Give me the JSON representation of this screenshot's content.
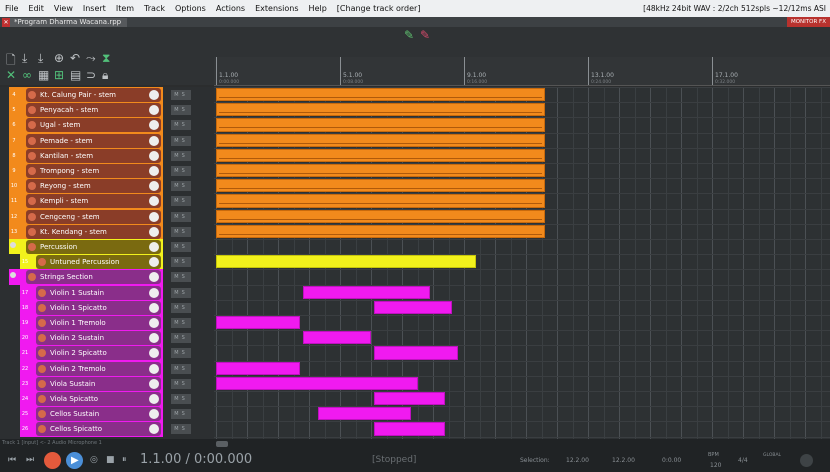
{
  "menu": {
    "items": [
      "File",
      "Edit",
      "View",
      "Insert",
      "Item",
      "Track",
      "Options",
      "Actions",
      "Extensions",
      "Help",
      "[Change track order]"
    ],
    "status": "[48kHz 24bit WAV : 2/2ch 512spls ~12/12ms ASI"
  },
  "project": {
    "tab": "*Program Dharma Wacana.rpp",
    "monitor": "MONITOR FX"
  },
  "ruler": [
    {
      "label": "1.1.00",
      "sub": "0:00.000"
    },
    {
      "label": "5.1.00",
      "sub": "0:08.000"
    },
    {
      "label": "9.1.00",
      "sub": "0:16.000"
    },
    {
      "label": "13.1.00",
      "sub": "0:24.000"
    },
    {
      "label": "17.1.00",
      "sub": "0:32.000"
    }
  ],
  "tracks": [
    {
      "num": "4",
      "name": "Kt. Calung Pair - stem",
      "color": "#f28a1c"
    },
    {
      "num": "5",
      "name": "Penyacah - stem",
      "color": "#f28a1c"
    },
    {
      "num": "6",
      "name": "Ugal - stem",
      "color": "#f28a1c"
    },
    {
      "num": "7",
      "name": "Pemade - stem",
      "color": "#f28a1c"
    },
    {
      "num": "8",
      "name": "Kantilan - stem",
      "color": "#f28a1c"
    },
    {
      "num": "9",
      "name": "Trompong - stem",
      "color": "#f28a1c"
    },
    {
      "num": "10",
      "name": "Reyong - stem",
      "color": "#f28a1c"
    },
    {
      "num": "11",
      "name": "Kempli - stem",
      "color": "#f28a1c"
    },
    {
      "num": "12",
      "name": "Cengceng - stem",
      "color": "#f28a1c"
    },
    {
      "num": "13",
      "name": "Kt. Kendang - stem",
      "color": "#f28a1c"
    },
    {
      "num": "",
      "name": "Percussion",
      "color": "#f2f21c",
      "folder": true
    },
    {
      "num": "15",
      "name": "Untuned Percussion",
      "color": "#f2f21c",
      "child": true
    },
    {
      "num": "",
      "name": "Strings Section",
      "color": "#f01af0",
      "folder": true
    },
    {
      "num": "17",
      "name": "Violin 1 Sustain",
      "color": "#f01af0",
      "child": true
    },
    {
      "num": "18",
      "name": "Violin 1 Spicatto",
      "color": "#f01af0",
      "child": true
    },
    {
      "num": "19",
      "name": "Violin 1 Tremolo",
      "color": "#f01af0",
      "child": true
    },
    {
      "num": "20",
      "name": "Violin 2 Sustain",
      "color": "#f01af0",
      "child": true
    },
    {
      "num": "21",
      "name": "Violin 2 Spicatto",
      "color": "#f01af0",
      "child": true
    },
    {
      "num": "22",
      "name": "Violin 2 Tremolo",
      "color": "#f01af0",
      "child": true
    },
    {
      "num": "23",
      "name": "Viola Sustain",
      "color": "#f01af0",
      "child": true
    },
    {
      "num": "24",
      "name": "Viola Spicatto",
      "color": "#f01af0",
      "child": true
    },
    {
      "num": "25",
      "name": "Cellos Sustain",
      "color": "#f01af0",
      "child": true
    },
    {
      "num": "26",
      "name": "Cellos Spicatto",
      "color": "#f01af0",
      "child": true
    }
  ],
  "items": [
    {
      "row": 0,
      "type": "orange",
      "start_bar": 1,
      "end_bar": 11.6
    },
    {
      "row": 1,
      "type": "orange",
      "start_bar": 1,
      "end_bar": 11.6
    },
    {
      "row": 2,
      "type": "orange",
      "start_bar": 1,
      "end_bar": 11.6
    },
    {
      "row": 3,
      "type": "orange",
      "start_bar": 1,
      "end_bar": 11.6
    },
    {
      "row": 4,
      "type": "orange",
      "start_bar": 1,
      "end_bar": 11.6
    },
    {
      "row": 5,
      "type": "orange",
      "start_bar": 1,
      "end_bar": 11.6
    },
    {
      "row": 6,
      "type": "orange",
      "start_bar": 1,
      "end_bar": 11.6
    },
    {
      "row": 7,
      "type": "orange",
      "start_bar": 1,
      "end_bar": 11.6
    },
    {
      "row": 8,
      "type": "orange",
      "start_bar": 1,
      "end_bar": 11.6
    },
    {
      "row": 9,
      "type": "orange",
      "start_bar": 1,
      "end_bar": 11.6
    },
    {
      "row": 11,
      "type": "yellow",
      "start_bar": 1,
      "end_bar": 9.4
    },
    {
      "row": 13,
      "type": "mag",
      "start_bar": 3.8,
      "end_bar": 7.9
    },
    {
      "row": 14,
      "type": "mag",
      "start_bar": 6.1,
      "end_bar": 8.6
    },
    {
      "row": 15,
      "type": "mag",
      "start_bar": 1,
      "end_bar": 3.7
    },
    {
      "row": 16,
      "type": "mag",
      "start_bar": 3.8,
      "end_bar": 6.0
    },
    {
      "row": 17,
      "type": "mag",
      "start_bar": 6.1,
      "end_bar": 8.8
    },
    {
      "row": 18,
      "type": "mag",
      "start_bar": 1,
      "end_bar": 3.7
    },
    {
      "row": 19,
      "type": "mag",
      "start_bar": 1,
      "end_bar": 7.5
    },
    {
      "row": 20,
      "type": "mag",
      "start_bar": 6.1,
      "end_bar": 8.4
    },
    {
      "row": 21,
      "type": "mag",
      "start_bar": 4.3,
      "end_bar": 7.3
    },
    {
      "row": 22,
      "type": "mag",
      "start_bar": 6.1,
      "end_bar": 8.4
    }
  ],
  "transport": {
    "position": "1.1.00 / 0:00.000",
    "state": "[Stopped]",
    "selection_label": "Selection:",
    "sel_start": "12.2.00",
    "sel_end": "12.2.00",
    "sel_len": "0:0.00",
    "bpm_label": "BPM",
    "bpm": "120",
    "timesig": "4/4",
    "global": "GLOBAL",
    "track_input": "Track 1 [input] <- 2 Audio Microphone 1"
  }
}
